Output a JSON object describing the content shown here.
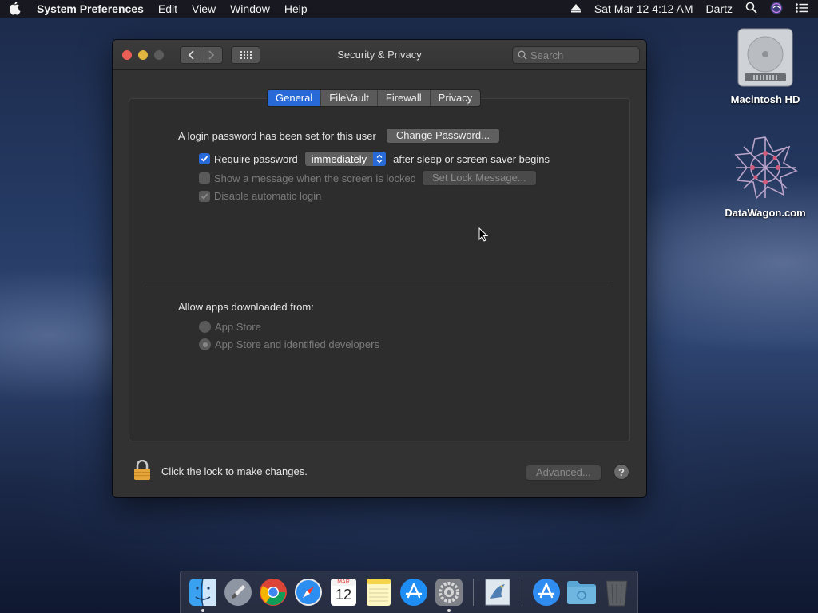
{
  "menubar": {
    "app_name": "System Preferences",
    "menus": [
      "Edit",
      "View",
      "Window",
      "Help"
    ],
    "datetime": "Sat Mar 12  4:12 AM",
    "user": "Dartz"
  },
  "desktop": {
    "icons": [
      {
        "label": "Macintosh HD"
      },
      {
        "label": "DataWagon.com"
      }
    ]
  },
  "window": {
    "title": "Security & Privacy",
    "search_placeholder": "Search",
    "tabs": [
      {
        "label": "General",
        "active": true
      },
      {
        "label": "FileVault",
        "active": false
      },
      {
        "label": "Firewall",
        "active": false
      },
      {
        "label": "Privacy",
        "active": false
      }
    ],
    "general": {
      "login_text": "A login password has been set for this user",
      "change_password_label": "Change Password...",
      "require_password_label": "Require password",
      "require_password_value": "immediately",
      "require_password_suffix": "after sleep or screen saver begins",
      "show_message_label": "Show a message when the screen is locked",
      "set_lock_message_label": "Set Lock Message...",
      "disable_login_label": "Disable automatic login",
      "allow_apps_label": "Allow apps downloaded from:",
      "radio_app_store": "App Store",
      "radio_identified": "App Store and identified developers"
    },
    "footer": {
      "lock_text": "Click the lock to make changes.",
      "advanced_label": "Advanced...",
      "help_label": "?"
    }
  },
  "dock": {
    "calendar_month": "MAR",
    "calendar_day": "12"
  },
  "colors": {
    "accent": "#2869d8",
    "window_bg": "#323232",
    "lock": "#e6a53a"
  }
}
